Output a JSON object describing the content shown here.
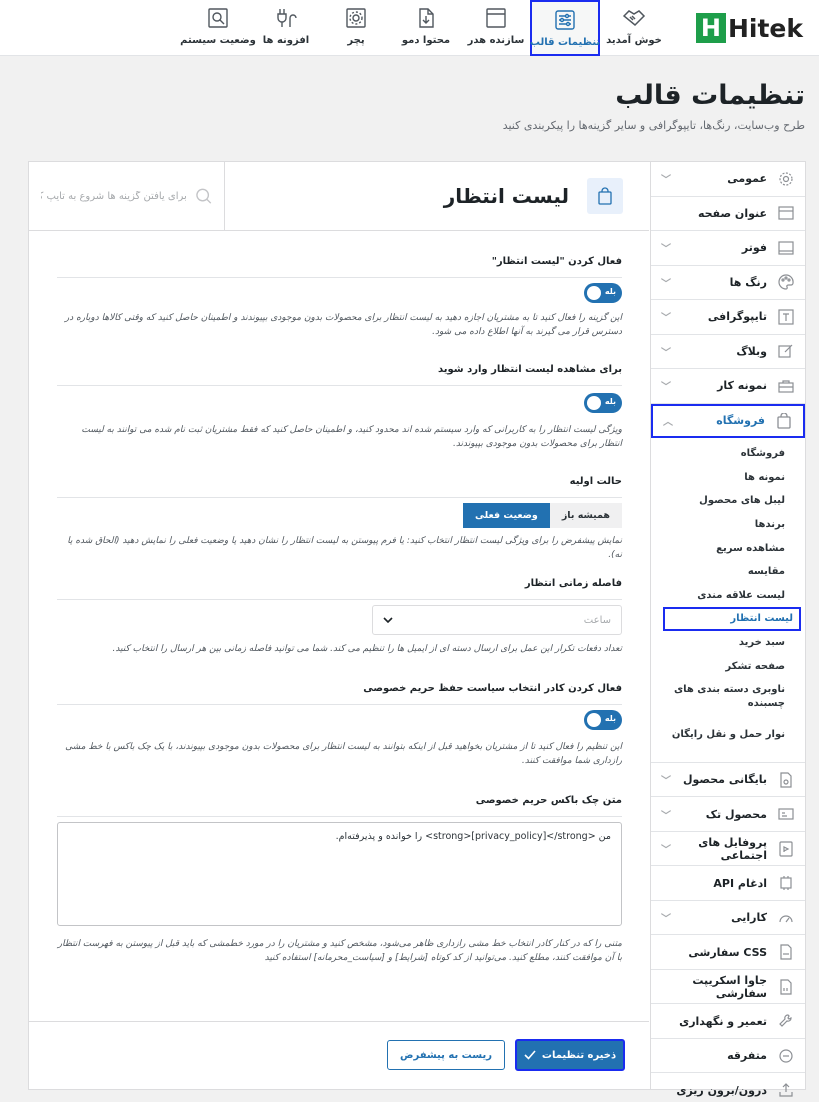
{
  "brand": {
    "logo_letter": "H",
    "logo_text": "Hitek"
  },
  "nav_tabs": [
    {
      "label": "خوش آمدید",
      "icon": "handshake-icon"
    },
    {
      "label": "تنظیمات قالب",
      "icon": "sliders-icon",
      "active": true
    },
    {
      "label": "سازنده هدر",
      "icon": "window-icon"
    },
    {
      "label": "محتوا دمو",
      "icon": "file-import-icon"
    },
    {
      "label": "پچر",
      "icon": "gear-box-icon"
    },
    {
      "label": "افزونه ها",
      "icon": "plug-icon"
    },
    {
      "label": "وضعیت سیستم",
      "icon": "gear-search-icon"
    }
  ],
  "page": {
    "title": "تنظیمات قالب",
    "subtitle": "طرح وب‌سایت، رنگ‌ها، تایپوگرافی و سایر گزینه‌ها را پیکربندی کنید"
  },
  "sidebar": {
    "items_top": [
      {
        "label": "عمومی",
        "icon": "gear-icon",
        "chevron": true
      },
      {
        "label": "عنوان صفحه",
        "icon": "title-bar-icon",
        "chevron": false
      },
      {
        "label": "فوتر",
        "icon": "footer-icon",
        "chevron": true
      },
      {
        "label": "رنگ ها",
        "icon": "palette-icon",
        "chevron": true
      },
      {
        "label": "تایپوگرافی",
        "icon": "typography-icon",
        "chevron": true
      },
      {
        "label": "وبلاگ",
        "icon": "edit-icon",
        "chevron": true
      },
      {
        "label": "نمونه کار",
        "icon": "briefcase-icon",
        "chevron": true
      }
    ],
    "active_item": {
      "label": "فروشگاه",
      "icon": "shopping-bag-icon"
    },
    "sub_items": [
      "فروشگاه",
      "نمونه ها",
      "لیبل های محصول",
      "برندها",
      "مشاهده سریع",
      "مقایسه",
      "لیست علاقه مندی",
      "لیست انتظار",
      "سبد خرید",
      "صفحه تشکر",
      "ناوبری دسته بندی های چسبنده",
      "نوار حمل و نقل رایگان"
    ],
    "active_sub": "لیست انتظار",
    "items_bottom": [
      {
        "label": "بایگانی محصول",
        "icon": "archive-icon",
        "chevron": true
      },
      {
        "label": "محصول تک",
        "icon": "product-icon",
        "chevron": true
      },
      {
        "label": "پروفایل های اجتماعی",
        "icon": "social-icon",
        "chevron": true
      },
      {
        "label": "ادغام API",
        "icon": "api-icon",
        "chevron": false
      },
      {
        "label": "کارایی",
        "icon": "speedometer-icon",
        "chevron": true
      },
      {
        "label": "CSS سفارشی",
        "icon": "css-file-icon",
        "chevron": false
      },
      {
        "label": "جاوا اسکریپت سفارشی",
        "icon": "js-file-icon",
        "chevron": false
      },
      {
        "label": "تعمیر و نگهداری",
        "icon": "wrench-icon",
        "chevron": false
      },
      {
        "label": "متفرقه",
        "icon": "more-icon",
        "chevron": false
      },
      {
        "label": "درون/برون ریزی",
        "icon": "upload-icon",
        "chevron": false
      }
    ]
  },
  "section": {
    "title": "لیست انتظار",
    "search_placeholder": "برای یافتن گزینه ها شروع به تایپ ک"
  },
  "fields": {
    "f1": {
      "label": "فعال کردن \"لیست انتظار\"",
      "toggle": "بله",
      "desc": "این گزینه را فعال کنید تا به مشتریان اجازه دهید به لیست انتظار برای محصولات بدون موجودی بپیوندند و اطمینان حاصل کنید که وقتی کالاها دوباره در دسترس قرار می گیرند به آنها اطلاع داده می شود."
    },
    "f2": {
      "label": "برای مشاهده لیست انتظار وارد شوید",
      "toggle": "بله",
      "desc": "ویژگی لیست انتظار را به کاربرانی که وارد سیستم شده اند محدود کنید، و اطمینان حاصل کنید که فقط مشتریان ثبت نام شده می توانند به لیست انتظار برای محصولات بدون موجودی بپیوندند."
    },
    "f3": {
      "label": "حالت اولیه",
      "opt1": "همیشه باز",
      "opt2": "وضعیت فعلی",
      "desc": "نمایش پیشفرض را برای ویژگی لیست انتظار انتخاب کنید: یا فرم پیوستن به لیست انتظار را نشان دهید یا وضعیت فعلی را نمایش دهید (الحاق شده یا نه)."
    },
    "f4": {
      "label": "فاصله زمانی انتظار",
      "select_value": "ساعت",
      "desc": "تعداد دفعات تکرار این عمل برای ارسال دسته ای از ایمیل ها را تنظیم می کند. شما می توانید فاصله زمانی بین هر ارسال را انتخاب کنید."
    },
    "f5": {
      "label": "فعال کردن کادر انتخاب سیاست حفظ حریم خصوصی",
      "toggle": "بله",
      "desc": "این تنظیم را فعال کنید تا از مشتریان بخواهید قبل از اینکه بتوانند به لیست انتظار برای محصولات بدون موجودی بپیوندند، با یک چک باکس با خط مشی رازداری شما موافقت کنند."
    },
    "f6": {
      "label": "متن چک باکس حریم خصوصی",
      "value": "من <strong>[privacy_policy]</strong> را خوانده و پذیرفته‌ام.",
      "desc": "متنی را که در کنار کادر انتخاب خط مشی رازداری ظاهر می‌شود، مشخص کنید و مشتریان را در مورد خطمشی که باید قبل از پیوستن به فهرست انتظار با آن موافقت کنند، مطلع کنید. می‌توانید از کد کوتاه [شرایط] و [سیاست_محرمانه] استفاده کنید"
    }
  },
  "footer": {
    "save_label": "ذخیره تنظیمات",
    "reset_label": "ریست به پیشفرض"
  },
  "colors": {
    "accent": "#2271b1",
    "highlight": "#1a2cf0",
    "brand": "#1e9e4a"
  }
}
